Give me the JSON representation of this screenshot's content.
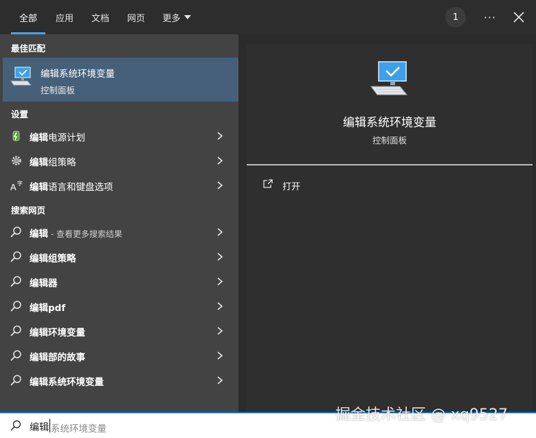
{
  "tabs": {
    "all": "全部",
    "apps": "应用",
    "documents": "文档",
    "web": "网页",
    "more": "更多"
  },
  "header": {
    "badge_count": "1",
    "more_options": "···"
  },
  "best_match": {
    "section_title": "最佳匹配",
    "title": "编辑系统环境变量",
    "subtitle": "控制面板"
  },
  "settings": {
    "section_title": "设置",
    "items": [
      {
        "bold": "编辑",
        "rest": "电源计划",
        "icon": "battery-icon"
      },
      {
        "bold": "编辑",
        "rest": "组策略",
        "icon": "gear-icon"
      },
      {
        "bold": "编辑",
        "rest": "语言和键盘选项",
        "icon": "language-icon"
      }
    ]
  },
  "web_search": {
    "section_title": "搜索网页",
    "items": [
      {
        "bold": "编辑",
        "rest": "",
        "muted": " - 查看更多搜索结果"
      },
      {
        "bold": "编辑组策略",
        "rest": "",
        "muted": ""
      },
      {
        "bold": "编辑器",
        "rest": "",
        "muted": ""
      },
      {
        "bold": "编辑pdf",
        "rest": "",
        "muted": ""
      },
      {
        "bold": "编辑环境变量",
        "rest": "",
        "muted": ""
      },
      {
        "bold": "编辑部的故事",
        "rest": "",
        "muted": ""
      },
      {
        "bold": "编辑系统环境变量",
        "rest": "",
        "muted": ""
      }
    ]
  },
  "preview": {
    "title": "编辑系统环境变量",
    "subtitle": "控制面板",
    "action_open": "打开"
  },
  "search": {
    "typed": "编辑",
    "completion": "系统环境变量"
  },
  "watermark": "掘金技术社区 @ xq9527",
  "colors": {
    "accent": "#4aa3f0",
    "selected_row": "#46607a",
    "left_panel": "#434343",
    "right_panel": "#2f2f2f"
  }
}
